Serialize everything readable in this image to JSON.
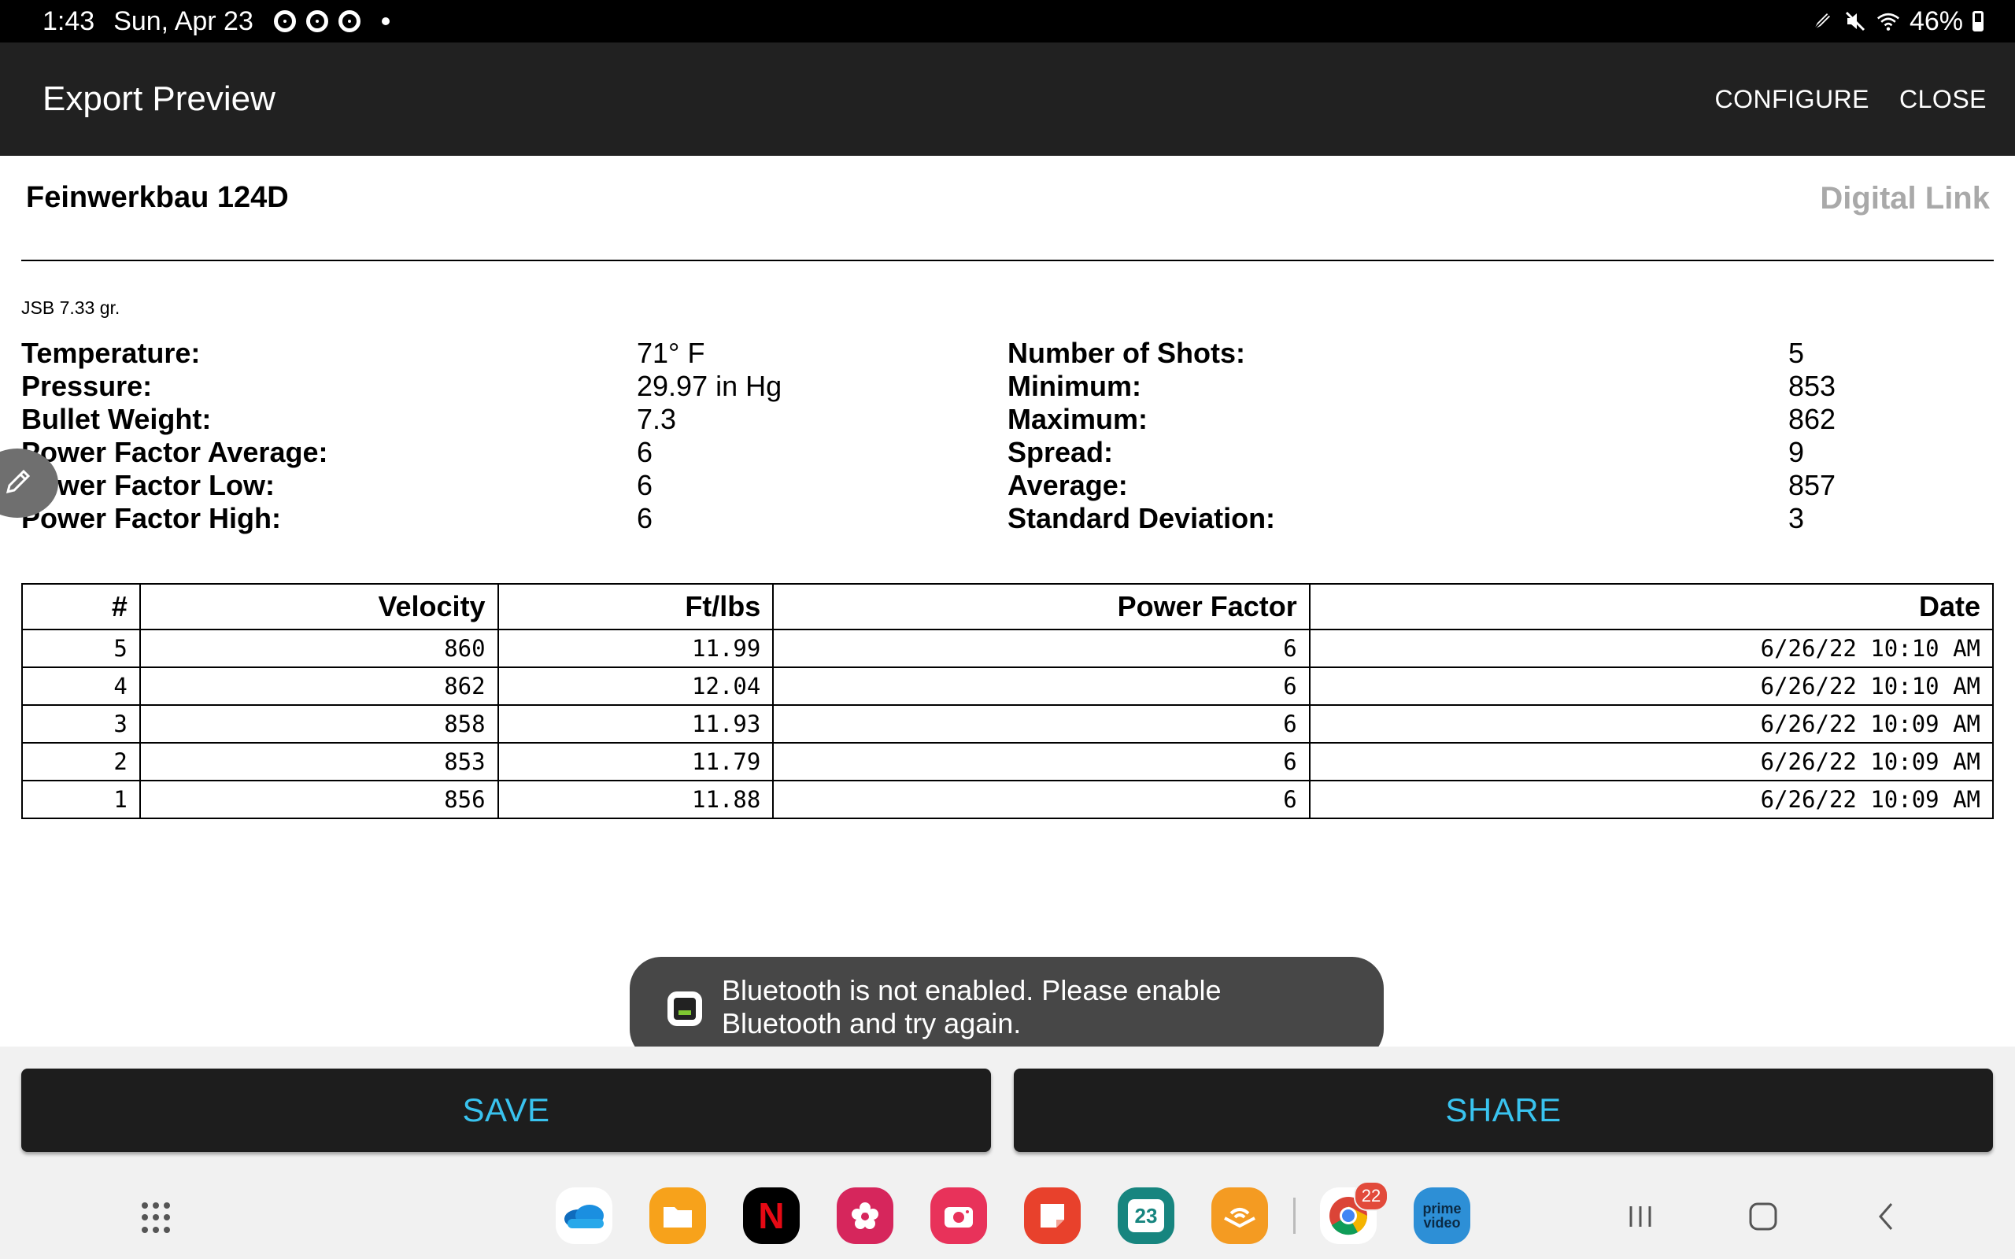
{
  "status_bar": {
    "time": "1:43",
    "date": "Sun, Apr 23",
    "battery": "46%",
    "battery_level": 0.46,
    "icons": [
      "chrome-icon",
      "chrome-icon",
      "chrome-icon",
      "more-notifications-dot",
      "pen-icon",
      "mute-icon",
      "wifi-icon",
      "battery-icon"
    ]
  },
  "app_bar": {
    "title": "Export Preview",
    "configure_label": "CONFIGURE",
    "close_label": "CLOSE"
  },
  "report": {
    "title": "Feinwerkbau 124D",
    "brand": "Digital Link",
    "ammo": "JSB 7.33 gr.",
    "left_stats": [
      {
        "label": "Temperature:",
        "value": "71° F"
      },
      {
        "label": "Pressure:",
        "value": "29.97 in Hg"
      },
      {
        "label": "Bullet Weight:",
        "value": "7.3"
      },
      {
        "label": "Power Factor Average:",
        "value": "6"
      },
      {
        "label": "Power Factor Low:",
        "value": "6"
      },
      {
        "label": "Power Factor High:",
        "value": "6"
      }
    ],
    "right_stats": [
      {
        "label": "Number of Shots:",
        "value": "5"
      },
      {
        "label": "Minimum:",
        "value": "853"
      },
      {
        "label": "Maximum:",
        "value": "862"
      },
      {
        "label": "Spread:",
        "value": "9"
      },
      {
        "label": "Average:",
        "value": "857"
      },
      {
        "label": "Standard Deviation:",
        "value": "3"
      }
    ]
  },
  "table": {
    "headers": [
      "#",
      "Velocity",
      "Ft/lbs",
      "Power Factor",
      "Date"
    ],
    "rows": [
      [
        "5",
        "860",
        "11.99",
        "6",
        "6/26/22 10:10 AM"
      ],
      [
        "4",
        "862",
        "12.04",
        "6",
        "6/26/22 10:10 AM"
      ],
      [
        "3",
        "858",
        "11.93",
        "6",
        "6/26/22 10:09 AM"
      ],
      [
        "2",
        "853",
        "11.79",
        "6",
        "6/26/22 10:09 AM"
      ],
      [
        "1",
        "856",
        "11.88",
        "6",
        "6/26/22 10:09 AM"
      ]
    ]
  },
  "toast": {
    "line1": "Bluetooth is not enabled.  Please enable",
    "line2": "Bluetooth and try again."
  },
  "buttons": {
    "save_label": "SAVE",
    "share_label": "SHARE"
  },
  "dock": {
    "apps": [
      {
        "name": "onedrive-icon",
        "color": "#ffffff"
      },
      {
        "name": "my-files-icon",
        "color": "#f7a21b"
      },
      {
        "name": "netflix-icon",
        "color": "#000000"
      },
      {
        "name": "blossom-app-icon",
        "color": "#d6265c"
      },
      {
        "name": "camera-app-icon",
        "color": "#e8325a"
      },
      {
        "name": "notes-app-icon",
        "color": "#e8412c"
      },
      {
        "name": "calendar-icon",
        "color": "#17857f",
        "label": "23"
      },
      {
        "name": "audible-icon",
        "color": "#f49b22"
      },
      {
        "name": "chrome-icon",
        "color": "#ffffff"
      },
      {
        "name": "prime-video-icon",
        "color": "#2d8fd6",
        "label": "prime video"
      }
    ],
    "chrome_badge": "22"
  },
  "colors": {
    "app_bar": "#212121",
    "button_text": "#39c3ef",
    "brand_text": "#a9a9a9",
    "toast_bg": "#474747"
  }
}
